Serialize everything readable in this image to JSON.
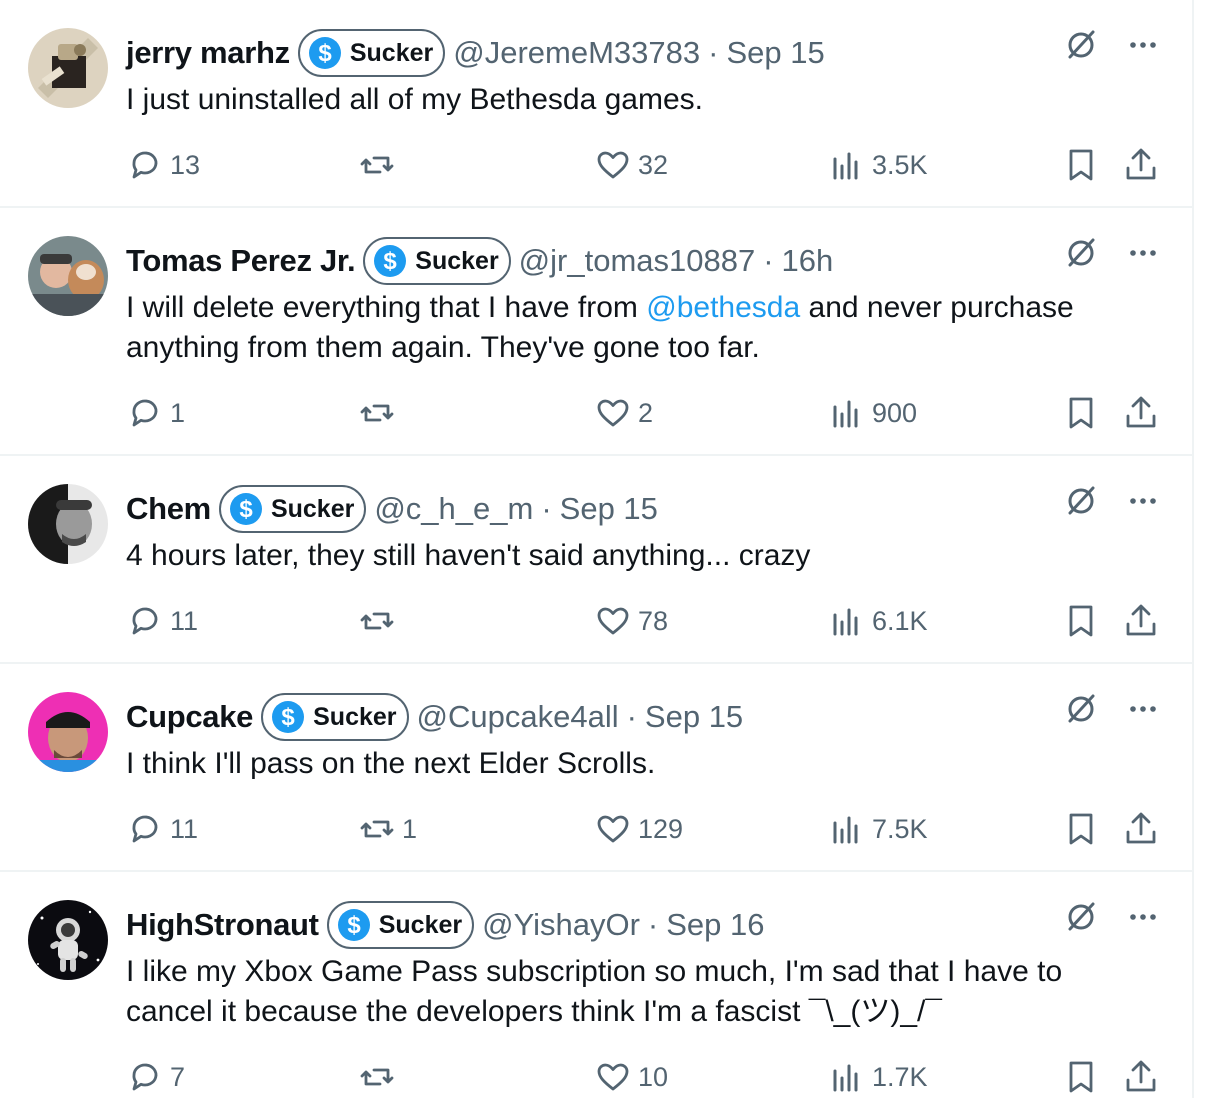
{
  "badge_label": "Sucker",
  "colors": {
    "accent": "#1d9bf0",
    "muted": "#536471",
    "text": "#0f1419",
    "divider": "#eff3f4"
  },
  "icons": {
    "badge": "dollar-coin-icon",
    "translate": "slashed-circle-icon",
    "more": "more-dots-icon",
    "reply": "reply-icon",
    "retweet": "retweet-icon",
    "like": "heart-icon",
    "views": "views-icon",
    "bookmark": "bookmark-icon",
    "share": "share-icon"
  },
  "tweets": [
    {
      "name": "jerry marhz",
      "handle": "@JeremeM33783",
      "sep": "·",
      "time": "Sep 15",
      "text_before": "I just uninstalled all of my Bethesda games.",
      "mention": "",
      "text_after": "",
      "replies": "13",
      "retweets": "",
      "likes": "32",
      "views": "3.5K"
    },
    {
      "name": "Tomas Perez Jr.",
      "handle": "@jr_tomas10887",
      "sep": "·",
      "time": "16h",
      "text_before": "I will delete everything that I have from ",
      "mention": "@bethesda",
      "text_after": "  and never purchase anything from them again. They've gone too far.",
      "replies": "1",
      "retweets": "",
      "likes": "2",
      "views": "900"
    },
    {
      "name": "Chem",
      "handle": "@c_h_e_m",
      "sep": "·",
      "time": "Sep 15",
      "text_before": "4 hours later, they still haven't said anything... crazy",
      "mention": "",
      "text_after": "",
      "replies": "11",
      "retweets": "",
      "likes": "78",
      "views": "6.1K"
    },
    {
      "name": "Cupcake",
      "handle": "@Cupcake4all",
      "sep": "·",
      "time": "Sep 15",
      "text_before": "I think I'll pass on the next Elder Scrolls.",
      "mention": "",
      "text_after": "",
      "replies": "11",
      "retweets": "1",
      "likes": "129",
      "views": "7.5K"
    },
    {
      "name": "HighStronaut",
      "handle": "@YishayOr",
      "sep": "·",
      "time": "Sep 16",
      "text_before": "I like my Xbox Game Pass subscription so much, I'm sad that I have to cancel it because the developers think I'm a fascist ¯\\_(ツ)_/¯",
      "mention": "",
      "text_after": "",
      "replies": "7",
      "retweets": "",
      "likes": "10",
      "views": "1.7K"
    }
  ]
}
